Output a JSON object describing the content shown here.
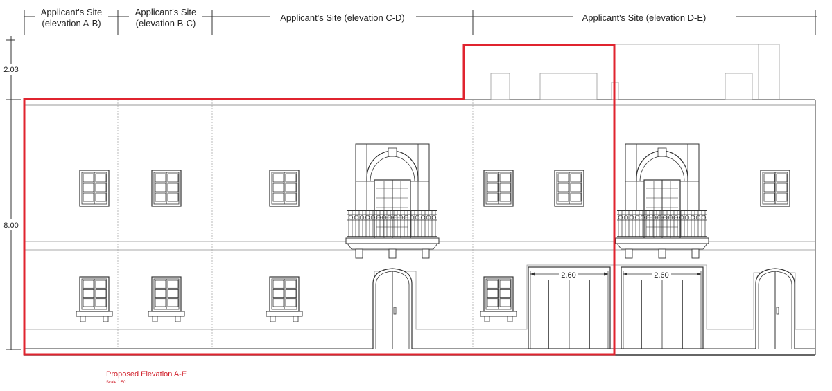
{
  "dimensions": {
    "top": [
      {
        "line1": "Applicant's Site",
        "line2": "(elevation A-B)"
      },
      {
        "line1": "Applicant's Site",
        "line2": "(elevation B-C)"
      },
      {
        "line1": "Applicant's Site (elevation C-D)"
      },
      {
        "line1": "Applicant's Site (elevation D-E)"
      }
    ],
    "left": [
      "2.03",
      "8.00"
    ],
    "garage_widths": [
      "2.60",
      "2.60"
    ]
  },
  "caption": {
    "title": "Proposed Elevation A-E",
    "scale": "Scale 1:50"
  },
  "colors": {
    "highlight": "#e0242f",
    "line": "#333333",
    "faint": "#9a9a9a"
  }
}
